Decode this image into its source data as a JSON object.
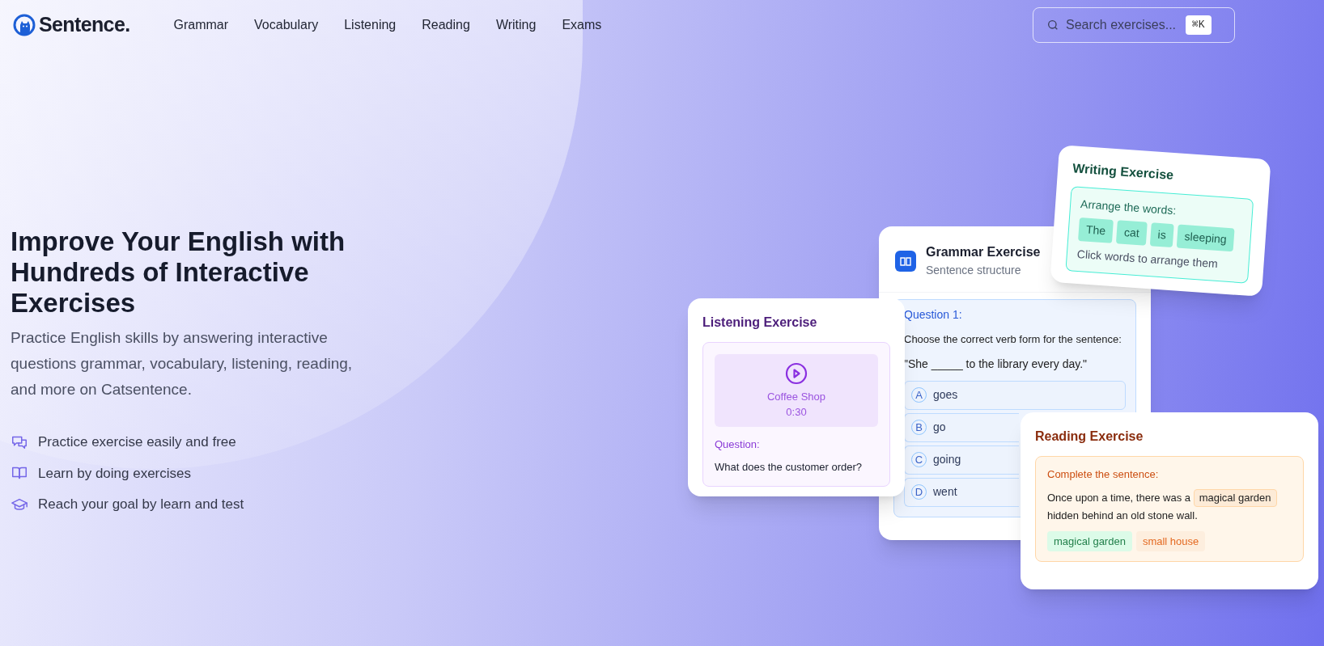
{
  "header": {
    "logo_text": "Sentence.",
    "nav": [
      {
        "label": "Grammar"
      },
      {
        "label": "Vocabulary"
      },
      {
        "label": "Listening"
      },
      {
        "label": "Reading"
      },
      {
        "label": "Writing"
      },
      {
        "label": "Exams"
      }
    ],
    "search": {
      "placeholder": "Search exercises...",
      "shortcut": "⌘K"
    }
  },
  "hero": {
    "title": "Improve Your English with Hundreds of Interactive Exercises",
    "description": "Practice English skills by answering interactive questions grammar, vocabulary, listening, reading, and more on Catsentence.",
    "features": [
      {
        "kind": "chat",
        "text": "Practice exercise easily and free"
      },
      {
        "kind": "book",
        "text": "Learn by doing exercises"
      },
      {
        "kind": "cap",
        "text": "Reach your goal by learn and test"
      }
    ]
  },
  "grammar_card": {
    "title": "Grammar Exercise",
    "subtitle": "Sentence structure",
    "question_label": "Question 1:",
    "prompt": "Choose the correct verb form for the sentence:",
    "sentence": "\"She _____ to the library every day.\"",
    "options": [
      {
        "letter": "A",
        "text": "goes"
      },
      {
        "letter": "B",
        "text": "go"
      },
      {
        "letter": "C",
        "text": "going"
      },
      {
        "letter": "D",
        "text": "went"
      }
    ]
  },
  "listening_card": {
    "title": "Listening Exercise",
    "audio_title": "Coffee Shop",
    "duration": "0:30",
    "question_label": "Question:",
    "question": "What does the customer order?"
  },
  "writing_card": {
    "title": "Writing Exercise",
    "instruction": "Arrange the words:",
    "words": [
      "The",
      "cat",
      "is",
      "sleeping"
    ],
    "hint": "Click words to arrange them"
  },
  "reading_card": {
    "title": "Reading Exercise",
    "instruction": "Complete the sentence:",
    "sentence_before": "Once upon a time, there was a",
    "filled_word": "magical garden",
    "sentence_after": "hidden behind an old stone wall.",
    "options": [
      {
        "text": "magical garden",
        "selected": true
      },
      {
        "text": "small house",
        "selected": false
      }
    ]
  }
}
